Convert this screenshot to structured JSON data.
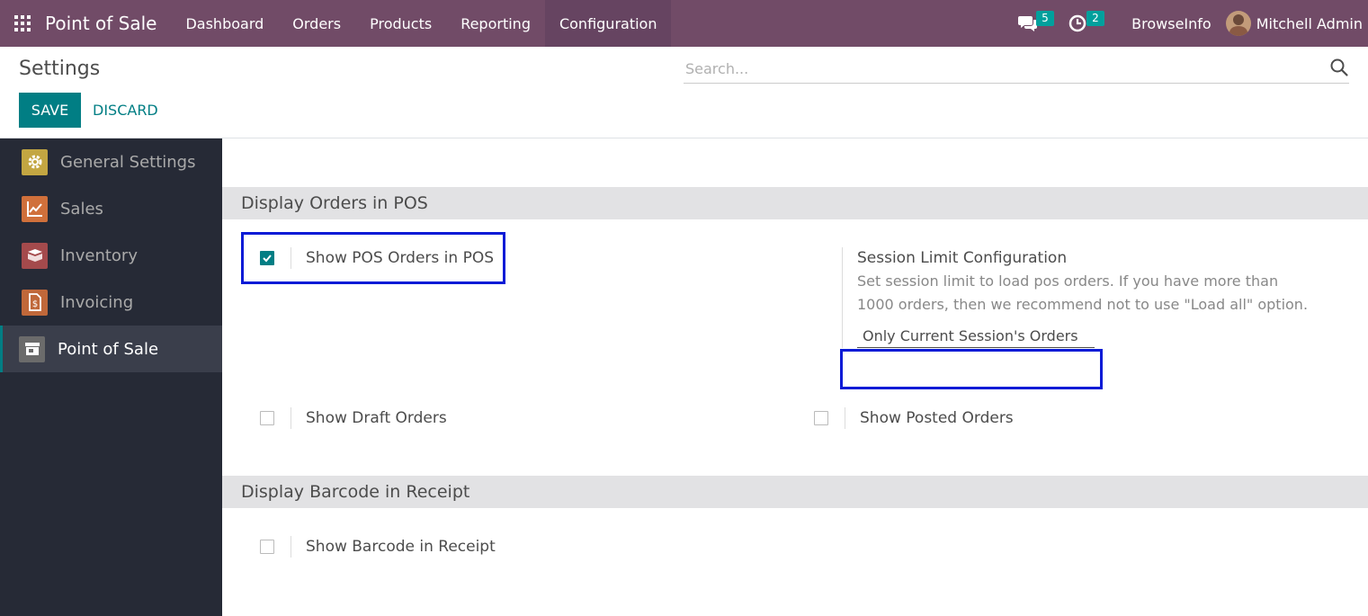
{
  "navbar": {
    "brand": "Point of Sale",
    "menu": [
      "Dashboard",
      "Orders",
      "Products",
      "Reporting",
      "Configuration"
    ],
    "active_menu": "Configuration",
    "messages_count": "5",
    "activities_count": "2",
    "company": "BrowseInfo",
    "user": "Mitchell Admin"
  },
  "control_panel": {
    "title": "Settings",
    "save_label": "SAVE",
    "discard_label": "DISCARD",
    "search_placeholder": "Search..."
  },
  "sidebar": {
    "items": [
      {
        "label": "General Settings",
        "icon": "gear-icon",
        "color": "#c3a642"
      },
      {
        "label": "Sales",
        "icon": "chart-icon",
        "color": "#d0703b"
      },
      {
        "label": "Inventory",
        "icon": "box-icon",
        "color": "#a44a4c"
      },
      {
        "label": "Invoicing",
        "icon": "invoice-icon",
        "color": "#c0683a"
      },
      {
        "label": "Point of Sale",
        "icon": "store-icon",
        "color": "#6b6b6b"
      }
    ],
    "active": "Point of Sale"
  },
  "sections": {
    "display_orders": {
      "title": "Display Orders in POS",
      "show_pos_orders": {
        "label": "Show POS Orders in POS",
        "checked": true
      },
      "session_limit": {
        "label": "Session Limit Configuration",
        "description": "Set session limit to load pos orders. If you have more than 1000 orders, then we recommend not to use \"Load all\" option.",
        "value": "Only Current Session's Orders"
      },
      "show_draft": {
        "label": "Show Draft Orders",
        "checked": false
      },
      "show_posted": {
        "label": "Show Posted Orders",
        "checked": false
      }
    },
    "display_barcode": {
      "title": "Display Barcode in Receipt",
      "show_barcode": {
        "label": "Show Barcode in Receipt",
        "checked": false
      }
    }
  },
  "colors": {
    "navbar": "#714b67",
    "primary": "#017e84",
    "sidebar": "#262a36",
    "highlight": "#0a1bd6"
  }
}
